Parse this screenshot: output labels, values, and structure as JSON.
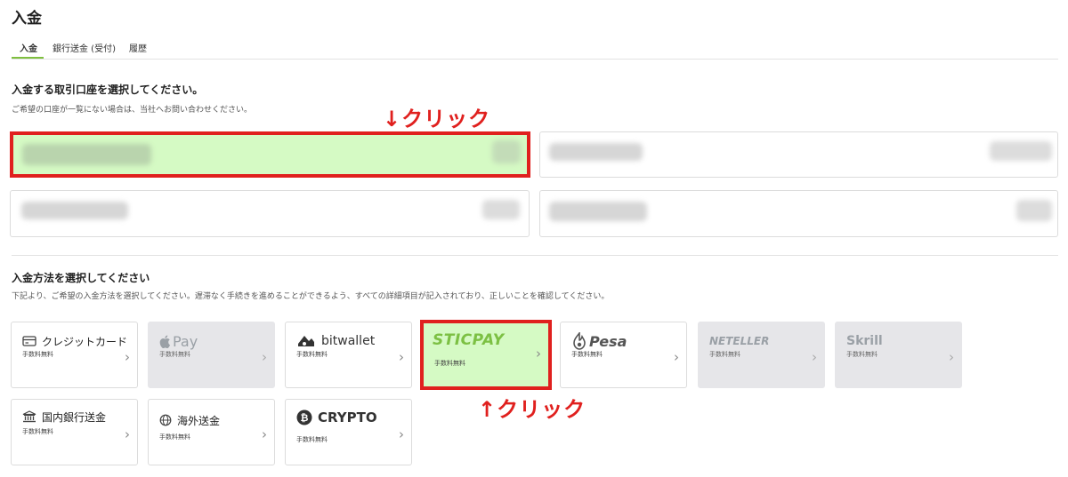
{
  "page": {
    "title": "入金"
  },
  "tabs": [
    {
      "label": "入金",
      "active": true
    },
    {
      "label": "銀行送金 (受付)",
      "active": false
    },
    {
      "label": "履歴",
      "active": false
    }
  ],
  "accounts_section": {
    "title": "入金する取引口座を選択してください。",
    "description": "ご希望の口座が一覧にない場合は、当社へお問い合わせください。",
    "note": "account names are blurred in the original screenshot"
  },
  "methods_section": {
    "title": "入金方法を選択してください",
    "description": "下記より、ご希望の入金方法を選択してください。遅滞なく手続きを進めることができるよう、すべての詳細項目が記入されており、正しいことを確認してください。"
  },
  "methods": [
    {
      "name": "クレジットカード",
      "fee": "手数料無料",
      "icon": "credit-card-icon",
      "available": true
    },
    {
      "name": "Pay",
      "fee": "手数料無料",
      "icon": "apple-icon",
      "available": false
    },
    {
      "name": "bitwallet",
      "fee": "手数料無料",
      "icon": "bitwallet-icon",
      "available": true
    },
    {
      "name": "STICPAY",
      "fee": "手数料無料",
      "icon": "sticpay-logo",
      "available": true,
      "highlighted": true
    },
    {
      "name": "Pesa",
      "fee": "手数料無料",
      "icon": "pesa-logo",
      "available": true
    },
    {
      "name": "NETELLER",
      "fee": "手数料無料",
      "icon": "neteller-logo",
      "available": false
    },
    {
      "name": "Skrill",
      "fee": "手数料無料",
      "icon": "skrill-logo",
      "available": false
    },
    {
      "name": "国内銀行送金",
      "fee": "手数料無料",
      "icon": "bank-icon",
      "available": true
    },
    {
      "name": "海外送金",
      "fee": "手数料無料",
      "icon": "globe-icon",
      "available": true
    },
    {
      "name": "CRYPTO",
      "fee": "手数料無料",
      "icon": "bitcoin-icon",
      "available": true
    }
  ],
  "annotations": {
    "account_click": "↓クリック",
    "method_click": "↑クリック"
  },
  "colors": {
    "accent": "#7fbf3f",
    "highlight_bg": "#d5fac4",
    "highlight_border": "#e0201e",
    "annotation": "#e0201e",
    "disabled_bg": "#e6e6e9"
  }
}
